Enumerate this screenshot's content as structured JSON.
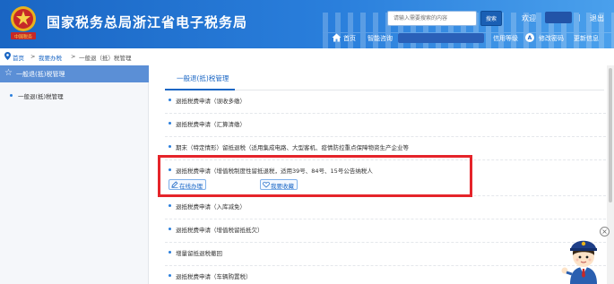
{
  "header": {
    "site_title": "国家税务总局浙江省电子税务局",
    "emblem_text": "中国税务",
    "search_placeholder": "请输入需要搜索的内容",
    "search_button": "搜索",
    "welcome": "欢迎",
    "separator": "|",
    "logout": "退出",
    "nav": {
      "home": "首页",
      "custom": "智能咨询",
      "credit": "信用等级",
      "credit_grade": "A",
      "change_password": "修改密码",
      "update_info": "更新信息"
    }
  },
  "breadcrumb": {
    "items": [
      "首页",
      "我要办税",
      "一般退（抵）税管理"
    ],
    "separator": ">"
  },
  "sidebar": {
    "header": "一般退(抵)税管理",
    "items": [
      {
        "label": "一般退(抵)税管理"
      }
    ]
  },
  "main": {
    "tab": "一般退(抵)税管理",
    "rows": [
      {
        "label": "退抵税费申请（误收多缴）"
      },
      {
        "label": "退抵税费申请（汇算清缴）"
      },
      {
        "label": "期末（特定情形）留抵退税（适用集成电路、大型客机、疫情防控重点保障物资生产企业等"
      },
      {
        "label": "退抵税费申请（增值税制度性留抵退税，适用39号、84号、15号公告纳税人"
      },
      {
        "label": "退抵税费申请（入库减免）"
      },
      {
        "label": "退抵税费申请（增值税留抵抵欠）"
      },
      {
        "label": "增量留抵退税撤回"
      },
      {
        "label": "退抵税费申请（车辆购置税）"
      }
    ],
    "actions": {
      "online": "在线办理",
      "favorite": "我要收藏"
    }
  },
  "colors": {
    "header_blue": "#1a66c4",
    "sidebar_active": "#5b8fd6",
    "highlight_red": "#e5242a"
  }
}
